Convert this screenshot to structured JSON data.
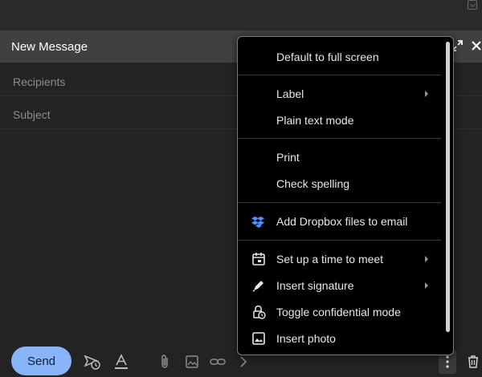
{
  "compose": {
    "title": "New Message",
    "recipients_placeholder": "Recipients",
    "subject_placeholder": "Subject",
    "send_label": "Send"
  },
  "menu": {
    "items": [
      {
        "label": "Default to full screen"
      },
      {
        "label": "Label",
        "submenu": true
      },
      {
        "label": "Plain text mode"
      },
      {
        "label": "Print"
      },
      {
        "label": "Check spelling"
      },
      {
        "label": "Add Dropbox files to email",
        "icon": "dropbox-icon"
      },
      {
        "label": "Set up a time to meet",
        "icon": "calendar-icon",
        "submenu": true
      },
      {
        "label": "Insert signature",
        "icon": "pen-icon",
        "submenu": true
      },
      {
        "label": "Toggle confidential mode",
        "icon": "lock-clock-icon"
      },
      {
        "label": "Insert photo",
        "icon": "photo-icon"
      }
    ]
  },
  "colors": {
    "send_button": "#8ab4f8",
    "dropbox": "#4a90ff",
    "menu_background": "#000000",
    "compose_header": "#404040"
  }
}
